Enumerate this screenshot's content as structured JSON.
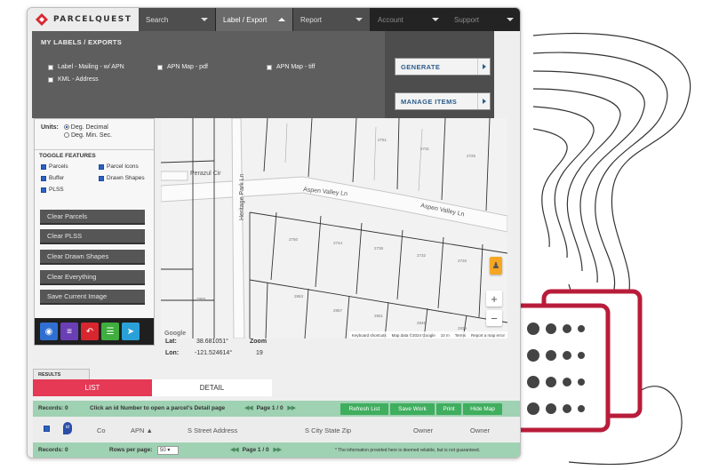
{
  "header": {
    "logo_text": "PARCELQUEST",
    "nav": [
      {
        "label": "Search"
      },
      {
        "label": "Label / Export"
      },
      {
        "label": "Report"
      },
      {
        "label": "Account"
      },
      {
        "label": "Support"
      }
    ]
  },
  "dropdown": {
    "title": "MY LABELS / EXPORTS",
    "options": [
      {
        "label": "Label - Mailing - w/ APN",
        "checked": false
      },
      {
        "label": "APN Map - pdf",
        "checked": false
      },
      {
        "label": "APN Map - tiff",
        "checked": false
      },
      {
        "label": "KML - Address",
        "checked": false
      }
    ],
    "generate_label": "GENERATE",
    "manage_label": "MANAGE ITEMS"
  },
  "left_panel": {
    "units_label": "Units:",
    "unit_options": [
      {
        "label": "Deg. Decimal",
        "selected": true
      },
      {
        "label": "Deg. Min. Sec.",
        "selected": false
      }
    ],
    "toggle_title": "TOGGLE FEATURES",
    "toggles": [
      {
        "label": "Parcels",
        "checked": true
      },
      {
        "label": "Parcel Icons",
        "checked": true
      },
      {
        "label": "Buffer",
        "checked": true
      },
      {
        "label": "Drawn Shapes",
        "checked": true
      },
      {
        "label": "PLSS",
        "checked": true
      }
    ],
    "buttons": [
      {
        "label": "Clear Parcels"
      },
      {
        "label": "Clear PLSS"
      },
      {
        "label": "Clear Drawn Shapes"
      },
      {
        "label": "Clear Everything"
      },
      {
        "label": "Save Current Image"
      }
    ],
    "tool_icons": [
      "eye-icon",
      "layers-icon",
      "undo-icon",
      "stack-icon",
      "pin-icon"
    ],
    "tool_colors": [
      "#2f6fd1",
      "#6a3fb5",
      "#d8262e",
      "#3fae3f",
      "#2aa0d8"
    ]
  },
  "map": {
    "streets": [
      "Perazul Cir",
      "Heritage Park Ln",
      "Aspen Valley Ln",
      "Aspen Valley Ln"
    ],
    "parcels": [
      "2751",
      "2731",
      "2725",
      "2750",
      "2744",
      "2738",
      "2732",
      "2726",
      "2869",
      "2863",
      "2857",
      "2851",
      "2845",
      "2839"
    ],
    "google": "Google",
    "attribution": [
      "Keyboard shortcuts",
      "Map data ©2024 Google",
      "10 m",
      "Terms",
      "Report a map error"
    ]
  },
  "coords": {
    "lat_label": "Lat:",
    "lat_value": "38.681051°",
    "lon_label": "Lon:",
    "lon_value": "-121.524614°",
    "zoom_label": "Zoom",
    "zoom_value": "19"
  },
  "results": {
    "tab_label": "RESULTS",
    "list_tab": "LIST",
    "detail_tab": "DETAIL",
    "records_label": "Records: 0",
    "hint": "Click an id Number to open a parcel's Detail page",
    "page_label": "Page 1 / 0",
    "actions": [
      "Refresh List",
      "Save Work",
      "Print",
      "Hide Map"
    ],
    "columns": [
      "Co",
      "APN",
      "S Street Address",
      "S City State Zip",
      "Owner",
      "Owner"
    ],
    "rows_per_page_label": "Rows per page:",
    "rows_per_page_value": "50",
    "disclaimer": "* The information provided here is deemed reliable, but is not guaranteed."
  },
  "colors": {
    "accent": "#e53955",
    "green": "#3fae5e",
    "green_bar": "#9fd1b3",
    "doc_icon": "#b81c3a"
  }
}
